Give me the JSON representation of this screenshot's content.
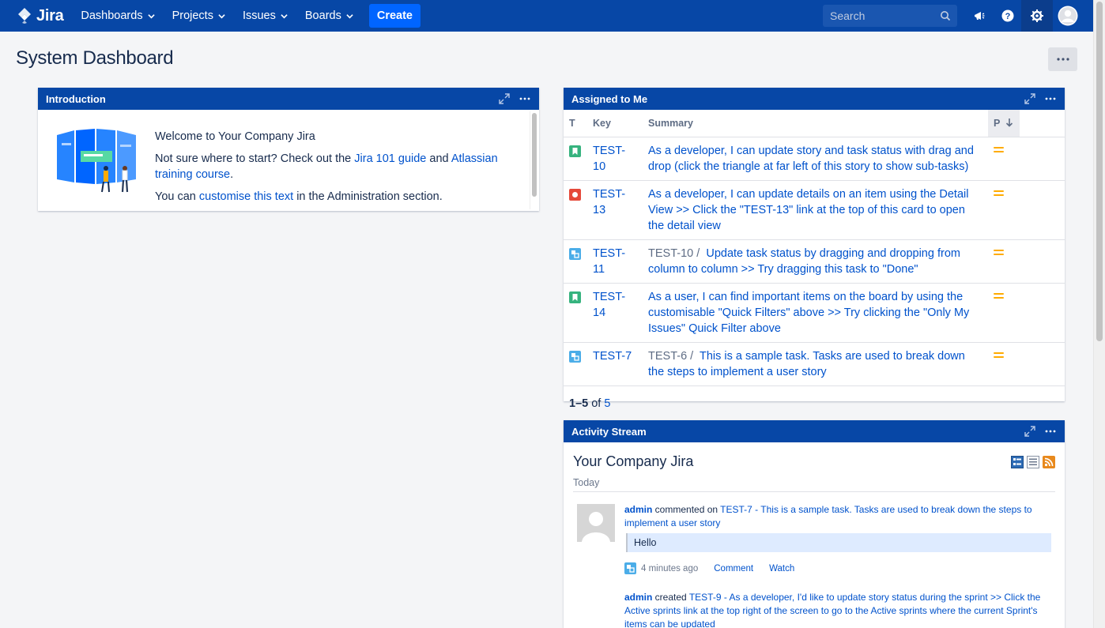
{
  "nav": {
    "brand": "Jira",
    "items": [
      {
        "label": "Dashboards"
      },
      {
        "label": "Projects"
      },
      {
        "label": "Issues"
      },
      {
        "label": "Boards"
      }
    ],
    "create_label": "Create",
    "search_placeholder": "Search"
  },
  "page": {
    "title": "System Dashboard"
  },
  "introduction": {
    "title": "Introduction",
    "welcome": "Welcome to Your Company Jira",
    "line2_prefix": "Not sure where to start? Check out the ",
    "link_jira101": "Jira 101 guide",
    "line2_mid": " and ",
    "link_training": "Atlassian training course",
    "line2_suffix": ".",
    "line3_prefix": "You can ",
    "link_customise": "customise this text",
    "line3_suffix": " in the Administration section."
  },
  "assigned": {
    "title": "Assigned to Me",
    "columns": {
      "type": "T",
      "key": "Key",
      "summary": "Summary",
      "priority": "P"
    },
    "rows": [
      {
        "type": "story",
        "key": "TEST-10",
        "parent": "",
        "summary": "As a developer, I can update story and task status with drag and drop (click the triangle at far left of this story to show sub-tasks)"
      },
      {
        "type": "bug",
        "key": "TEST-13",
        "parent": "",
        "summary": "As a developer, I can update details on an item using the Detail View >> Click the \"TEST-13\" link at the top of this card to open the detail view"
      },
      {
        "type": "subtask",
        "key": "TEST-11",
        "parent": "TEST-10 /",
        "summary": "Update task status by dragging and dropping from column to column >> Try dragging this task to \"Done\""
      },
      {
        "type": "story",
        "key": "TEST-14",
        "parent": "",
        "summary": "As a user, I can find important items on the board by using the customisable \"Quick Filters\" above >> Try clicking the \"Only My Issues\" Quick Filter above"
      },
      {
        "type": "subtask",
        "key": "TEST-7",
        "parent": "TEST-6 /",
        "summary": "This is a sample task. Tasks are used to break down the steps to implement a user story"
      }
    ],
    "pager_range": "1–5",
    "pager_of": " of ",
    "pager_total": "5"
  },
  "activity": {
    "title": "Activity Stream",
    "stream_title": "Your Company Jira",
    "day": "Today",
    "entries": [
      {
        "user": "admin",
        "verb": " commented on ",
        "target": "TEST-7 - This is a sample task. Tasks are used to break down the steps to implement a user story"
      },
      {
        "user": "admin",
        "verb": " created ",
        "target": "TEST-9 - As a developer, I'd like to update story status during the sprint >> Click the Active sprints link at the top right of the screen to go to the Active sprints where the current Sprint's items can be updated"
      }
    ],
    "comment": "Hello",
    "time": "4 minutes ago",
    "comment_link": "Comment",
    "watch_link": "Watch"
  },
  "colors": {
    "nav_bg": "#0747a6",
    "link": "#0052cc",
    "create_bg": "#0065ff",
    "story": "#36b37e",
    "bug": "#e5493a",
    "subtask": "#4bade8",
    "priority_medium": "#ffab00"
  }
}
